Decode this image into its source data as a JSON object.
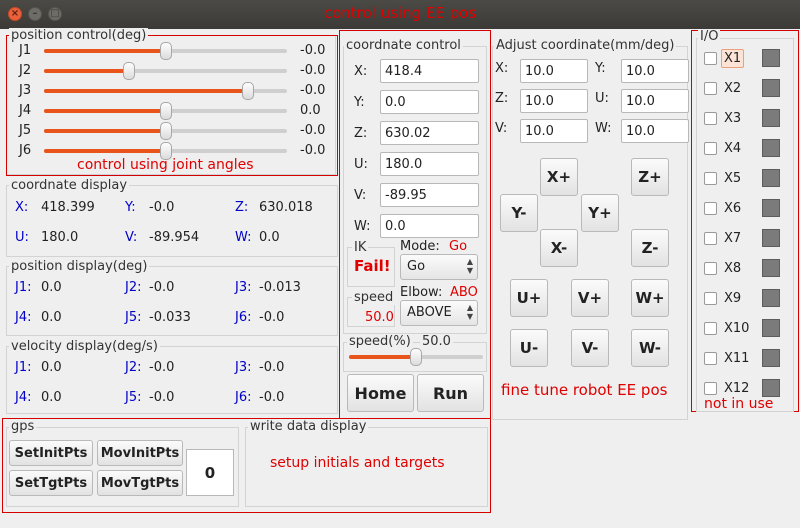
{
  "window": {
    "title": "control using EE pos"
  },
  "joint_control": {
    "title": "position control(deg)",
    "caption": "control using joint angles",
    "joints": [
      {
        "label": "J1",
        "value": "-0.0",
        "level": 0.5
      },
      {
        "label": "J2",
        "value": "-0.0",
        "level": 0.35
      },
      {
        "label": "J3",
        "value": "-0.0",
        "level": 0.84
      },
      {
        "label": "J4",
        "value": "0.0",
        "level": 0.5
      },
      {
        "label": "J5",
        "value": "-0.0",
        "level": 0.5
      },
      {
        "label": "J6",
        "value": "-0.0",
        "level": 0.5
      }
    ]
  },
  "coord_display": {
    "title": "coordnate display",
    "items": [
      {
        "label": "X:",
        "value": "418.399"
      },
      {
        "label": "Y:",
        "value": "-0.0"
      },
      {
        "label": "Z:",
        "value": "630.018"
      },
      {
        "label": "U:",
        "value": "180.0"
      },
      {
        "label": "V:",
        "value": "-89.954"
      },
      {
        "label": "W:",
        "value": "0.0"
      }
    ]
  },
  "position_display": {
    "title": "position display(deg)",
    "items": [
      {
        "label": "J1:",
        "value": "0.0"
      },
      {
        "label": "J2:",
        "value": "-0.0"
      },
      {
        "label": "J3:",
        "value": "-0.013"
      },
      {
        "label": "J4:",
        "value": "0.0"
      },
      {
        "label": "J5:",
        "value": "-0.033"
      },
      {
        "label": "J6:",
        "value": "-0.0"
      }
    ]
  },
  "velocity_display": {
    "title": "velocity display(deg/s)",
    "items": [
      {
        "label": "J1:",
        "value": "0.0"
      },
      {
        "label": "J2:",
        "value": "-0.0"
      },
      {
        "label": "J3:",
        "value": "-0.0"
      },
      {
        "label": "J4:",
        "value": "0.0"
      },
      {
        "label": "J5:",
        "value": "-0.0"
      },
      {
        "label": "J6:",
        "value": "-0.0"
      }
    ]
  },
  "coord_control": {
    "title": "coordnate control",
    "fields": [
      {
        "label": "X:",
        "value": "418.4"
      },
      {
        "label": "Y:",
        "value": "0.0"
      },
      {
        "label": "Z:",
        "value": "630.02"
      },
      {
        "label": "U:",
        "value": "180.0"
      },
      {
        "label": "V:",
        "value": "-89.95"
      },
      {
        "label": "W:",
        "value": "0.0"
      }
    ],
    "ik_label": "IK",
    "ik_status": "Fail!",
    "mode_label": "Mode:",
    "mode_value": "Go",
    "mode_selected": "Go",
    "speed_label": "speed",
    "speed_value": "50.0",
    "elbow_label": "Elbow:",
    "elbow_value": "ABO",
    "elbow_selected": "ABOVE",
    "speed_pct_label": "speed(%)",
    "speed_pct_value": "50.0",
    "speed_pct_level": 0.5,
    "home_label": "Home",
    "run_label": "Run"
  },
  "adjust": {
    "title": "Adjust coordinate(mm/deg)",
    "fields": [
      {
        "label": "X:",
        "value": "10.0"
      },
      {
        "label": "Y:",
        "value": "10.0"
      },
      {
        "label": "Z:",
        "value": "10.0"
      },
      {
        "label": "U:",
        "value": "10.0"
      },
      {
        "label": "V:",
        "value": "10.0"
      },
      {
        "label": "W:",
        "value": "10.0"
      }
    ],
    "buttons": {
      "xp": "X+",
      "zp": "Z+",
      "ym": "Y-",
      "yp": "Y+",
      "xm": "X-",
      "zm": "Z-",
      "up": "U+",
      "vp": "V+",
      "wp": "W+",
      "um": "U-",
      "vm": "V-",
      "wm": "W-"
    },
    "caption": "fine tune robot EE pos"
  },
  "io": {
    "title": "I/O",
    "caption": "not in use",
    "items": [
      "X1",
      "X2",
      "X3",
      "X4",
      "X5",
      "X6",
      "X7",
      "X8",
      "X9",
      "X10",
      "X11",
      "X12"
    ]
  },
  "gps": {
    "title": "gps",
    "set_init": "SetInitPts",
    "mov_init": "MovInitPts",
    "set_tgt": "SetTgtPts",
    "mov_tgt": "MovTgtPts",
    "count": "0"
  },
  "write_data": {
    "title": "write data display",
    "caption": "setup initials and targets"
  },
  "colors": {
    "accent": "#e9541b",
    "annotation": "#e00000",
    "axis_label": "#0000c8",
    "window_bar": "#3e3d39"
  }
}
